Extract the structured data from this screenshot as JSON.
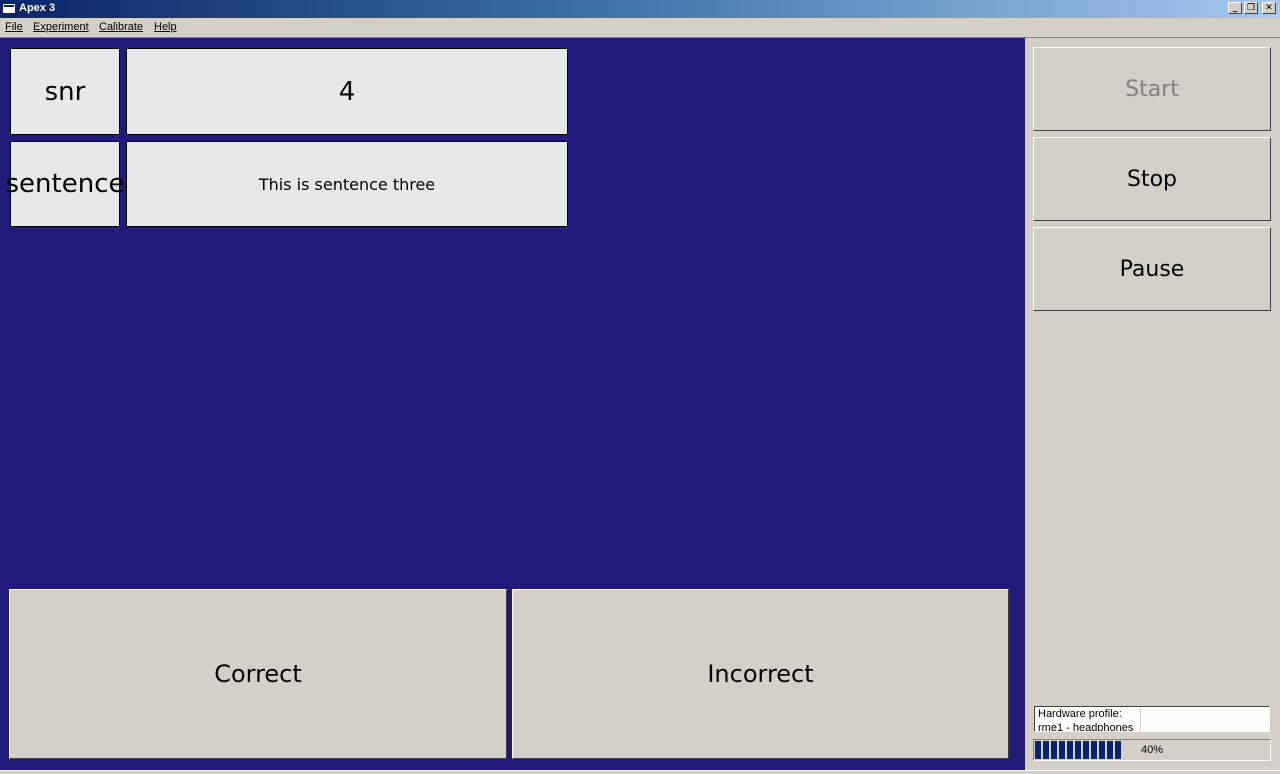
{
  "window": {
    "title": "Apex 3"
  },
  "menu": [
    {
      "label": "File"
    },
    {
      "label": "Experiment"
    },
    {
      "label": "Calibrate"
    },
    {
      "label": "Help"
    }
  ],
  "parameters": [
    {
      "label": "snr",
      "value": "4"
    },
    {
      "label": "sentence",
      "value": "This is sentence three"
    }
  ],
  "answers": {
    "correct": "Correct",
    "incorrect": "Incorrect"
  },
  "controls": {
    "start": "Start",
    "stop": "Stop",
    "pause": "Pause"
  },
  "status": {
    "hardware_profile": "Hardware profile:\nrme1 - headphones",
    "progress_percent": 40,
    "progress_label": "40%"
  },
  "colors": {
    "background": "#201a7a",
    "accent": "#0a246a"
  }
}
